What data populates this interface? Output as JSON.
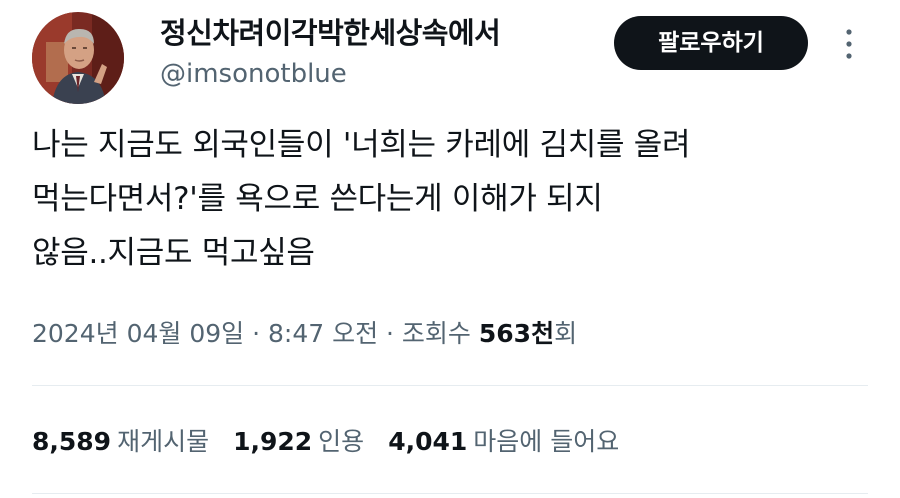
{
  "author": {
    "display_name": "정신차려이각박한세상속에서",
    "handle": "@imsonotblue",
    "avatar_icon": "profile-photo"
  },
  "follow_button": {
    "label": "팔로우하기"
  },
  "more_button": {
    "icon": "more-vertical-icon"
  },
  "tweet": {
    "lines": [
      "나는 지금도 외국인들이 '너희는 카레에 김치를 올려",
      "먹는다면서?'를 욕으로 쓴다는게 이해가 되지",
      "않음..지금도 먹고싶음"
    ]
  },
  "meta": {
    "date": "2024년 04월 09일",
    "separator": " · ",
    "time": "8:47 오전",
    "views_prefix": "조회수",
    "views_number": "563천",
    "views_suffix": "회"
  },
  "stats": {
    "retweets": {
      "count": "8,589",
      "label": "재게시물"
    },
    "quotes": {
      "count": "1,922",
      "label": "인용"
    },
    "likes": {
      "count": "4,041",
      "label": "마음에 들어요"
    }
  },
  "colors": {
    "text_primary": "#0f1419",
    "text_secondary": "#536471",
    "button_bg": "#0f1419",
    "button_text": "#ffffff",
    "divider": "#e6ecf0"
  }
}
